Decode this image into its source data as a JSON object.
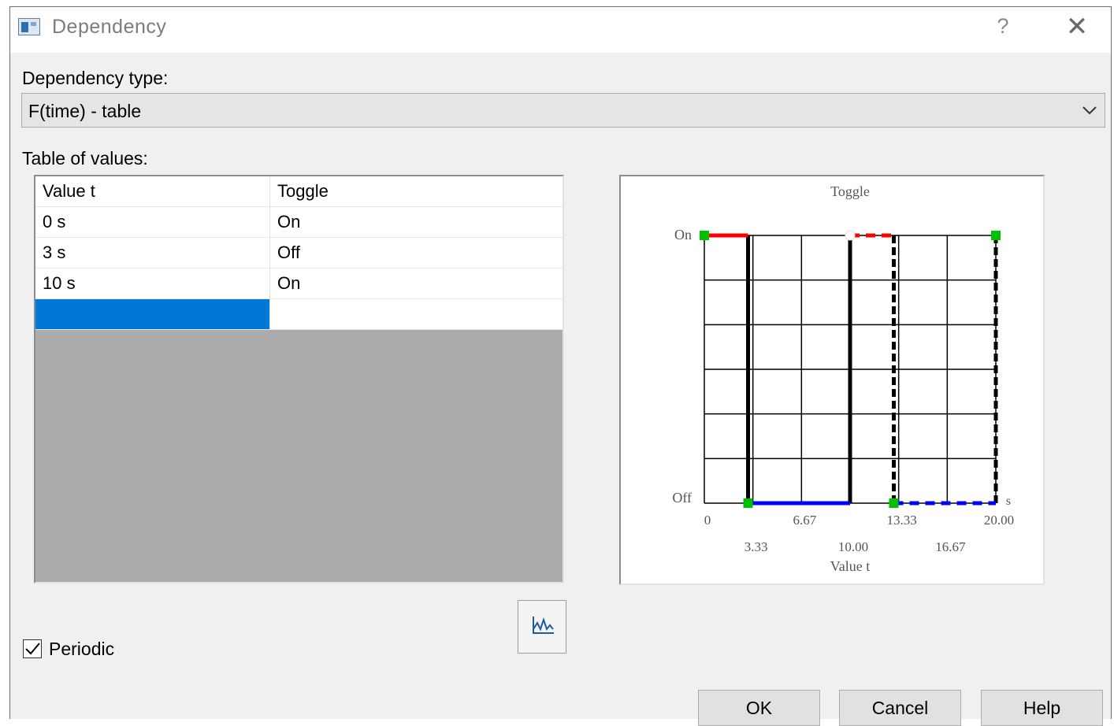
{
  "window": {
    "title": "Dependency",
    "help_glyph": "?",
    "close_glyph": "✕",
    "icon": "app-window-icon"
  },
  "dependency_type": {
    "label": "Dependency type:",
    "selected": "F(time) - table"
  },
  "table": {
    "label": "Table of values:",
    "columns": [
      "Value t",
      "Toggle"
    ],
    "rows": [
      [
        "0 s",
        "On"
      ],
      [
        "3 s",
        "Off"
      ],
      [
        "10 s",
        "On"
      ],
      [
        "",
        ""
      ]
    ],
    "selected_row": 3,
    "selection_color": "#0078d7",
    "empty_area_color": "#ababab"
  },
  "chart_data": {
    "type": "line",
    "title": "Toggle",
    "xlabel": "Value t",
    "x_unit": "s",
    "xlim": [
      0,
      20
    ],
    "x_ticks_upper": [
      "0",
      "6.67",
      "13.33",
      "20.00"
    ],
    "x_ticks_lower": [
      "3.33",
      "10.00",
      "16.67"
    ],
    "y_categories": [
      "Off",
      "On"
    ],
    "grid": true,
    "series": [
      {
        "style": "solid",
        "color": "#ff0000",
        "x": [
          0,
          3
        ],
        "y": [
          "On",
          "On"
        ]
      },
      {
        "style": "solid",
        "color": "#0000ff",
        "x": [
          3,
          10
        ],
        "y": [
          "Off",
          "Off"
        ]
      },
      {
        "style": "dashed",
        "color": "#ff0000",
        "x": [
          10,
          13
        ],
        "y": [
          "On",
          "On"
        ]
      },
      {
        "style": "dashed",
        "color": "#0000ff",
        "x": [
          13,
          20
        ],
        "y": [
          "Off",
          "Off"
        ]
      }
    ],
    "transitions": [
      {
        "x": 3,
        "style": "solid"
      },
      {
        "x": 10,
        "style": "solid"
      },
      {
        "x": 13,
        "style": "dashed"
      },
      {
        "x": 20,
        "style": "dashed"
      }
    ],
    "points": [
      {
        "x": 0,
        "y": "On",
        "color": "#00c000"
      },
      {
        "x": 3,
        "y": "Off",
        "color": "#00c000"
      },
      {
        "x": 10,
        "y": "On",
        "color": "#ffffff"
      },
      {
        "x": 13,
        "y": "Off",
        "color": "#00c000"
      },
      {
        "x": 20,
        "y": "On",
        "color": "#00c000"
      }
    ]
  },
  "graph_button": {
    "icon": "chart-icon"
  },
  "periodic": {
    "label": "Periodic",
    "checked": true
  },
  "buttons": {
    "ok": "OK",
    "cancel": "Cancel",
    "help": "Help"
  }
}
